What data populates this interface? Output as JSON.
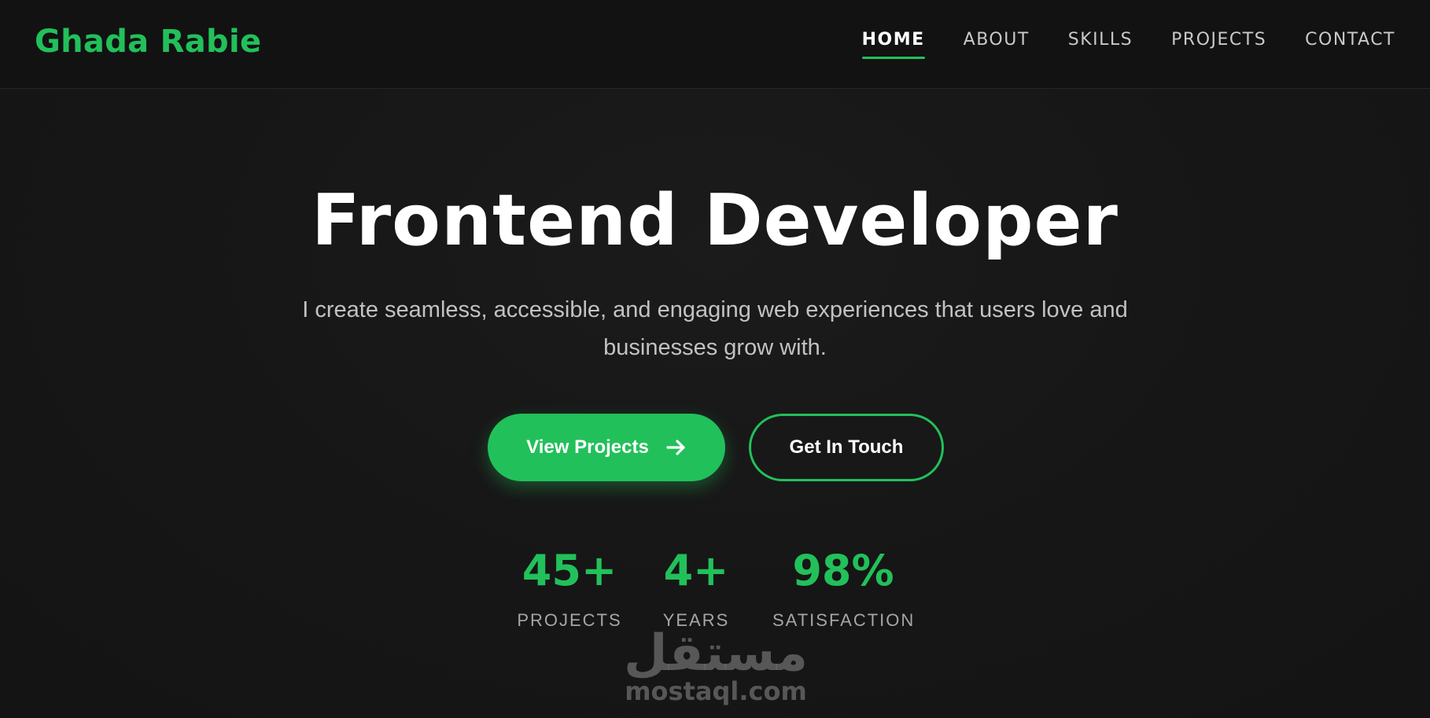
{
  "header": {
    "logo": "Ghada Rabie",
    "nav": [
      {
        "label": "HOME",
        "active": true
      },
      {
        "label": "ABOUT",
        "active": false
      },
      {
        "label": "SKILLS",
        "active": false
      },
      {
        "label": "PROJECTS",
        "active": false
      },
      {
        "label": "CONTACT",
        "active": false
      }
    ]
  },
  "hero": {
    "title": "Frontend Developer",
    "subtitle": "I create seamless, accessible, and engaging web experiences that users love and businesses grow with.",
    "primary_button": "View Projects",
    "primary_button_icon": "arrow-right-icon",
    "secondary_button": "Get In Touch"
  },
  "stats": [
    {
      "value": "45+",
      "label": "PROJECTS"
    },
    {
      "value": "4+",
      "label": "YEARS"
    },
    {
      "value": "98%",
      "label": "SATISFACTION"
    }
  ],
  "watermark": {
    "arabic": "مستقل",
    "latin": "mostaql.com"
  },
  "colors": {
    "accent": "#22c05a",
    "background": "#161616",
    "header_background": "#121212",
    "text_primary": "#ffffff",
    "text_secondary": "#c2c2c2"
  }
}
